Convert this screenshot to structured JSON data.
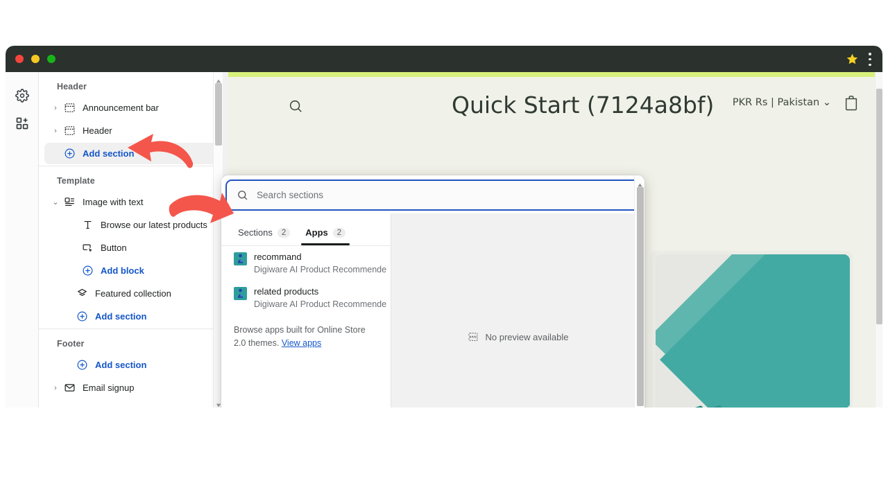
{
  "browser": {
    "traffic_lights": [
      "close",
      "minimize",
      "maximize"
    ],
    "star_icon": "star-icon",
    "menu_icon": "kebab-menu-icon",
    "titlebar_color": "#2b312c"
  },
  "rail": {
    "items": [
      {
        "name": "settings",
        "icon": "gear-icon"
      },
      {
        "name": "apps",
        "icon": "apps-grid-add-icon"
      }
    ]
  },
  "sidebar": {
    "groups": [
      {
        "title": "Header",
        "rows": [
          {
            "label": "Announcement bar",
            "icon": "section-icon",
            "caret": "›",
            "style": "normal"
          },
          {
            "label": "Header",
            "icon": "section-icon",
            "caret": "›",
            "style": "normal"
          },
          {
            "label": "Add section",
            "icon": "plus-circle-icon",
            "caret": "",
            "style": "link",
            "highlighted": true
          }
        ]
      },
      {
        "title": "Template",
        "rows": [
          {
            "label": "Image with text",
            "icon": "image-with-text-icon",
            "caret": "⌄",
            "style": "normal"
          },
          {
            "label": "Browse our latest products",
            "icon": "text-block-icon",
            "caret": "",
            "style": "indent"
          },
          {
            "label": "Button",
            "icon": "button-block-icon",
            "caret": "",
            "style": "indent"
          },
          {
            "label": "Add block",
            "icon": "plus-circle-icon",
            "caret": "",
            "style": "indent-link"
          },
          {
            "label": "Featured collection",
            "icon": "collection-icon",
            "caret": "",
            "style": "indent2"
          },
          {
            "label": "Add section",
            "icon": "plus-circle-icon",
            "caret": "",
            "style": "indent2-link"
          }
        ]
      },
      {
        "title": "Footer",
        "rows": [
          {
            "label": "Add section",
            "icon": "plus-circle-icon",
            "caret": "",
            "style": "indent2-link"
          },
          {
            "label": "Email signup",
            "icon": "email-icon",
            "caret": "›",
            "style": "normal"
          }
        ]
      }
    ]
  },
  "popup": {
    "search": {
      "placeholder": "Search sections",
      "value": "",
      "icon": "search-icon",
      "border_color": "#2353c0"
    },
    "tabs": [
      {
        "label": "Sections",
        "count": "2",
        "active": false
      },
      {
        "label": "Apps",
        "count": "2",
        "active": true
      }
    ],
    "apps": [
      {
        "name": "recommand",
        "subtitle": "Digiware AI Product Recommende",
        "icon": "app-icon"
      },
      {
        "name": "related products",
        "subtitle": "Digiware AI Product Recommende",
        "icon": "app-icon"
      }
    ],
    "browse_note": {
      "text": "Browse apps built for Online Store 2.0 themes.",
      "link": "View apps"
    },
    "preview": {
      "empty_text": "No preview available",
      "icon": "section-placeholder-icon"
    }
  },
  "storefront": {
    "title": "Quick Start (7124a8bf)",
    "locale": "PKR Rs | Pakistan",
    "locale_caret": "⌄",
    "cart_icon": "shopping-bag-icon",
    "search_icon": "search-icon",
    "accent_bar_color": "#d7f07c",
    "placeholder_color": "#42aaa3"
  },
  "annotations": {
    "arrows": [
      {
        "name": "arrow-to-add-section",
        "color": "#f4564b",
        "direction": "left"
      },
      {
        "name": "arrow-to-apps-list",
        "color": "#f4564b",
        "direction": "right"
      }
    ]
  }
}
